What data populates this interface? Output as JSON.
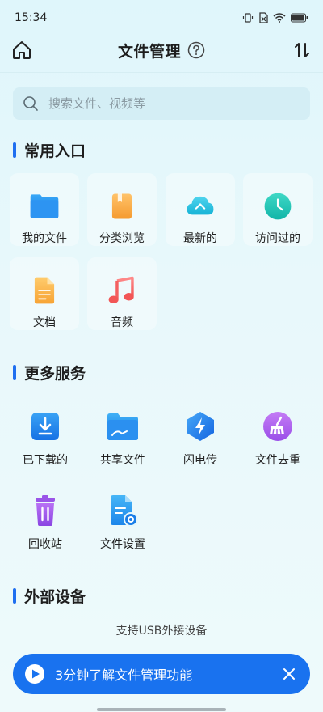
{
  "status": {
    "time": "15:34"
  },
  "header": {
    "title": "文件管理"
  },
  "search": {
    "placeholder": "搜索文件、视频等"
  },
  "sections": {
    "quick_access": {
      "title": "常用入口"
    },
    "more_services": {
      "title": "更多服务"
    },
    "external_devices": {
      "title": "外部设备"
    }
  },
  "quick_access_items": [
    {
      "label": "我的文件",
      "icon": "folder-icon"
    },
    {
      "label": "分类浏览",
      "icon": "category-book-icon"
    },
    {
      "label": "最新的",
      "icon": "cloud-up-icon"
    },
    {
      "label": "访问过的",
      "icon": "clock-icon"
    },
    {
      "label": "文档",
      "icon": "document-icon"
    },
    {
      "label": "音频",
      "icon": "music-note-icon"
    }
  ],
  "service_items": [
    {
      "label": "已下载的",
      "icon": "download-icon"
    },
    {
      "label": "共享文件",
      "icon": "shared-folder-icon"
    },
    {
      "label": "闪电传",
      "icon": "lightning-icon"
    },
    {
      "label": "文件去重",
      "icon": "broom-icon"
    },
    {
      "label": "回收站",
      "icon": "trash-icon"
    },
    {
      "label": "文件设置",
      "icon": "file-settings-icon"
    }
  ],
  "external": {
    "note": "支持USB外接设备"
  },
  "promo": {
    "text": "3分钟了解文件管理功能"
  },
  "colors": {
    "accent": "#1f6ff0",
    "promo_bg": "#1972ef",
    "search_bg": "#d4eef5"
  }
}
